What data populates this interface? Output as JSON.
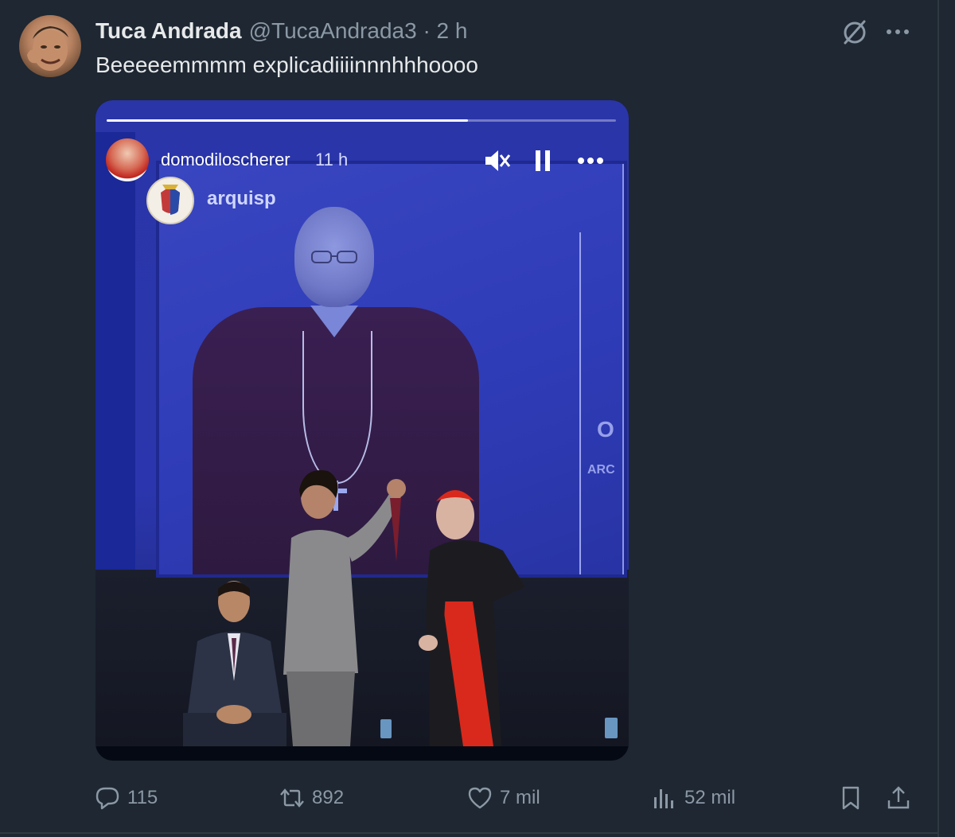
{
  "tweet": {
    "display_name": "Tuca Andrada",
    "handle_time": "@TucaAndrada3 · 2 h",
    "text": "Beeeeemmmm explicadiiiinnnhhhoooo"
  },
  "story": {
    "username": "domodiloscherer",
    "time": "11 h",
    "tagged_account": "arquisp",
    "progress": 0.71,
    "screen_letters": [
      "O",
      "ARC"
    ]
  },
  "actions": {
    "replies": "115",
    "reposts": "892",
    "likes": "7 mil",
    "views": "52 mil"
  },
  "colors": {
    "background": "#1e2732",
    "text_primary": "#e7e9ea",
    "text_secondary": "#8b98a5",
    "story_blue": "#2b36ae",
    "cardinal_red": "#d9291c"
  },
  "icons": [
    "grok-icon",
    "more-icon",
    "mute-icon",
    "pause-icon",
    "story-more-icon",
    "reply-icon",
    "repost-icon",
    "like-icon",
    "views-icon",
    "bookmark-icon",
    "share-icon"
  ]
}
